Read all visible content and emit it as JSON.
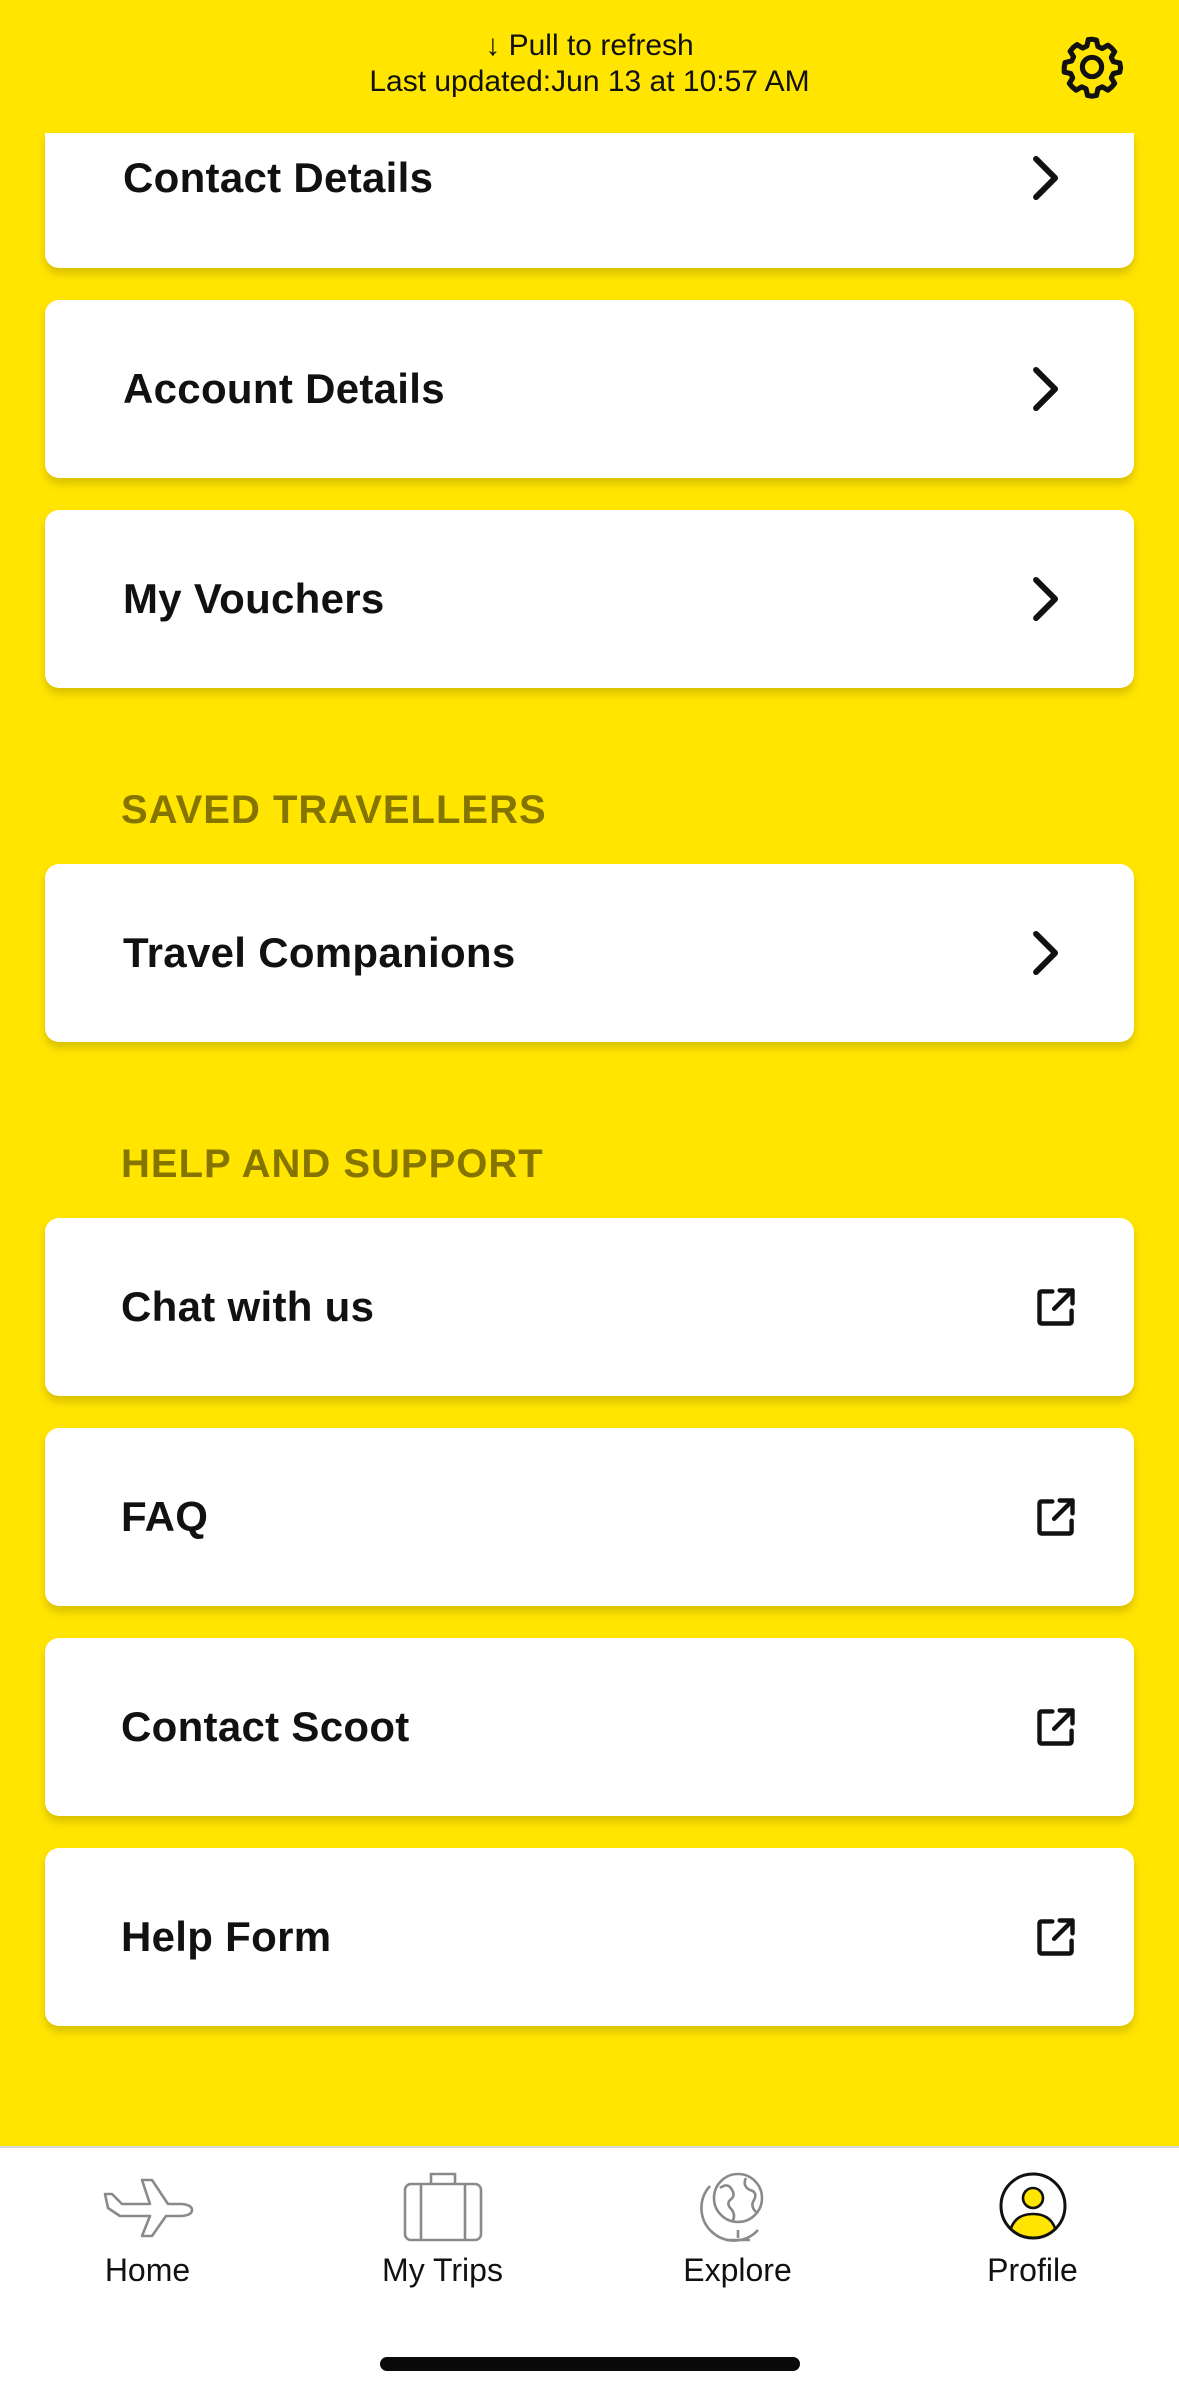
{
  "header": {
    "pull_hint": "↓ Pull to refresh",
    "last_updated": "Last updated:Jun 13 at 10:57 AM"
  },
  "account_items": [
    {
      "label": "Contact Details",
      "icon": "chevron-right-icon"
    },
    {
      "label": "Account Details",
      "icon": "chevron-right-icon"
    },
    {
      "label": "My Vouchers",
      "icon": "chevron-right-icon"
    }
  ],
  "saved_travellers": {
    "header": "SAVED TRAVELLERS",
    "items": [
      {
        "label": "Travel Companions",
        "icon": "chevron-right-icon"
      }
    ]
  },
  "help_support": {
    "header": "HELP AND SUPPORT",
    "items": [
      {
        "label": "Chat with us",
        "icon": "external-link-icon"
      },
      {
        "label": "FAQ",
        "icon": "external-link-icon"
      },
      {
        "label": "Contact Scoot",
        "icon": "external-link-icon"
      },
      {
        "label": "Help Form",
        "icon": "external-link-icon"
      }
    ]
  },
  "tab_bar": {
    "tabs": [
      {
        "label": "Home",
        "icon": "airplane-icon",
        "active": false
      },
      {
        "label": "My Trips",
        "icon": "suitcase-icon",
        "active": false
      },
      {
        "label": "Explore",
        "icon": "globe-icon",
        "active": false
      },
      {
        "label": "Profile",
        "icon": "profile-icon",
        "active": true
      }
    ]
  },
  "colors": {
    "background": "#FFE500",
    "section_header": "#857400",
    "card": "#FFFFFF",
    "text": "#111111"
  }
}
